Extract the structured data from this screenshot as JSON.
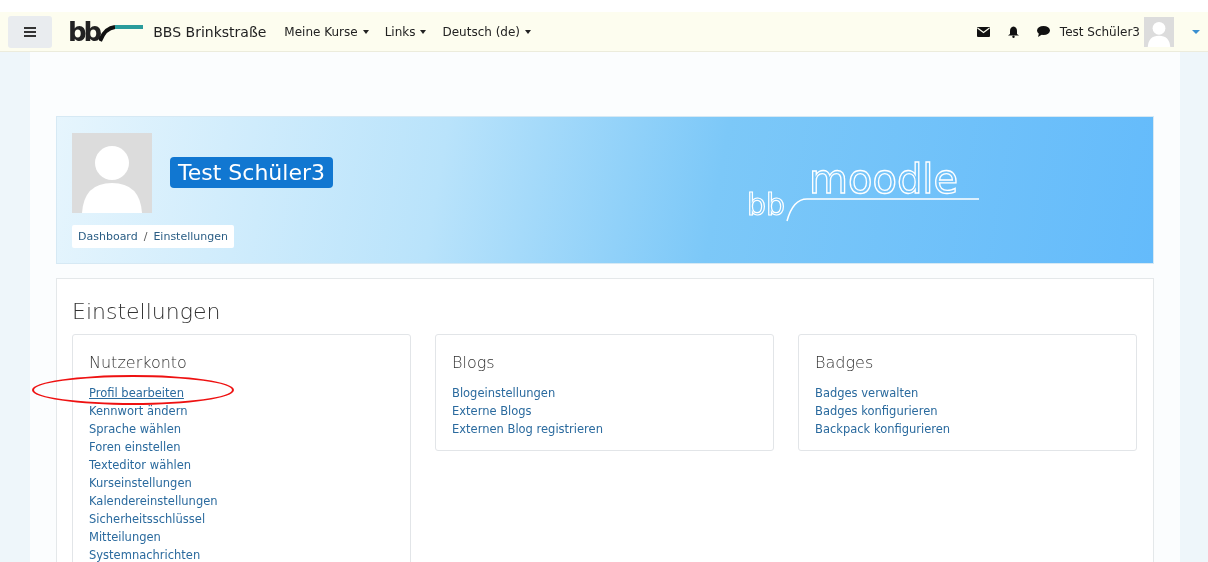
{
  "navbar": {
    "site_name": "BBS Brinkstraße",
    "logo_text": "bb",
    "menus": [
      {
        "label": "Meine Kurse"
      },
      {
        "label": "Links"
      },
      {
        "label": "Deutsch (de)"
      }
    ],
    "user_name": "Test Schüler3"
  },
  "page_header": {
    "user_name": "Test Schüler3",
    "breadcrumb": [
      "Dashboard",
      "Einstellungen"
    ],
    "breadcrumb_separator": "/",
    "banner_logo": {
      "prefix": "bb",
      "word": "moodle"
    }
  },
  "settings": {
    "title": "Einstellungen",
    "sections": [
      {
        "title": "Nutzerkonto",
        "links": [
          {
            "label": "Profil bearbeiten",
            "circled": true
          },
          {
            "label": "Kennwort ändern",
            "circled": false
          },
          {
            "label": "Sprache wählen",
            "circled": false
          },
          {
            "label": "Foren einstellen",
            "circled": false
          },
          {
            "label": "Texteditor wählen",
            "circled": false
          },
          {
            "label": "Kurseinstellungen",
            "circled": false
          },
          {
            "label": "Kalendereinstellungen",
            "circled": false
          },
          {
            "label": "Sicherheitsschlüssel",
            "circled": false
          },
          {
            "label": "Mitteilungen",
            "circled": false
          },
          {
            "label": "Systemnachrichten",
            "circled": false
          }
        ]
      },
      {
        "title": "Blogs",
        "links": [
          {
            "label": "Blogeinstellungen",
            "circled": false
          },
          {
            "label": "Externe Blogs",
            "circled": false
          },
          {
            "label": "Externen Blog registrieren",
            "circled": false
          }
        ]
      },
      {
        "title": "Badges",
        "links": [
          {
            "label": "Badges verwalten",
            "circled": false
          },
          {
            "label": "Badges konfigurieren",
            "circled": false
          },
          {
            "label": "Backpack konfigurieren",
            "circled": false
          }
        ]
      }
    ]
  }
}
